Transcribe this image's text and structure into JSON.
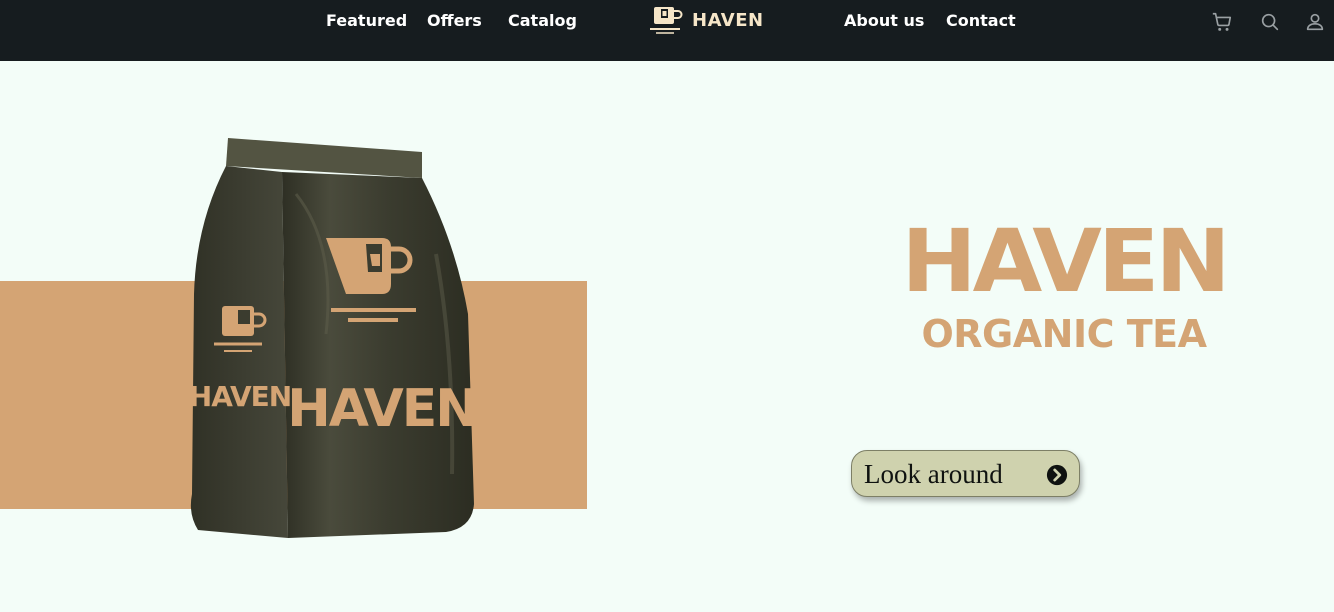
{
  "nav": {
    "links_left": [
      "Featured",
      "Offers",
      "Catalog"
    ],
    "brand": "HAVEN",
    "links_right": [
      "About us",
      "Contact"
    ],
    "icons": [
      "cart-icon",
      "search-icon",
      "user-icon"
    ]
  },
  "hero": {
    "title": "HAVEN",
    "subtitle": "ORGANIC TEA",
    "cta_label": "Look around",
    "product_brand": "HAVEN"
  },
  "colors": {
    "navbar": "#161c1f",
    "background": "#f3fdf8",
    "accent": "#d4a474",
    "bag": "#3f3f32",
    "cta": "#cfd2ae"
  }
}
